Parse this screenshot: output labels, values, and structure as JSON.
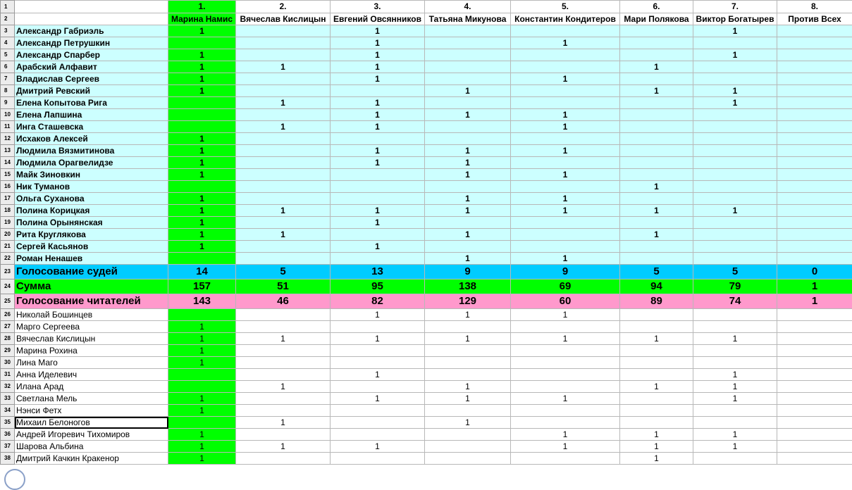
{
  "spreadsheet": {
    "row_numbers": [
      "1",
      "2",
      "3",
      "4",
      "5",
      "6",
      "7",
      "8",
      "9",
      "10",
      "11",
      "12",
      "13",
      "14",
      "15",
      "16",
      "17",
      "18",
      "19",
      "20",
      "21",
      "22",
      "23",
      "24",
      "25",
      "26",
      "27",
      "28",
      "29",
      "30",
      "31",
      "32",
      "33",
      "34",
      "35",
      "36",
      "37",
      "38"
    ],
    "candidate_numbers": [
      "1.",
      "2.",
      "3.",
      "4.",
      "5.",
      "6.",
      "7.",
      "8."
    ],
    "candidates": [
      "Марина Намис",
      "Вячеслав Кислицын",
      "Евгений Овсянников",
      "Татьяна Микунова",
      "Константин Кондитеров",
      "Мари Полякова",
      "Виктор Богатырев",
      "Против Всех"
    ],
    "judges": [
      {
        "name": "Александр Габриэль",
        "votes": [
          "1",
          "",
          "1",
          "",
          "",
          "",
          "1",
          ""
        ]
      },
      {
        "name": "Александр Петрушкин",
        "votes": [
          "",
          "",
          "1",
          "",
          "1",
          "",
          "",
          ""
        ]
      },
      {
        "name": "Александр Спарбер",
        "votes": [
          "1",
          "",
          "1",
          "",
          "",
          "",
          "1",
          ""
        ]
      },
      {
        "name": "Арабский Алфавит",
        "votes": [
          "1",
          "1",
          "1",
          "",
          "",
          "1",
          "",
          ""
        ]
      },
      {
        "name": "Владислав Сергеев",
        "votes": [
          "1",
          "",
          "1",
          "",
          "1",
          "",
          "",
          ""
        ]
      },
      {
        "name": "Дмитрий Ревский",
        "votes": [
          "1",
          "",
          "",
          "1",
          "",
          "1",
          "1",
          ""
        ]
      },
      {
        "name": "Елена Копытова Рига",
        "votes": [
          "",
          "1",
          "1",
          "",
          "",
          "",
          "1",
          ""
        ]
      },
      {
        "name": "Елена Лапшина",
        "votes": [
          "",
          "",
          "1",
          "1",
          "1",
          "",
          "",
          ""
        ]
      },
      {
        "name": "Инга Сташевска",
        "votes": [
          "",
          "1",
          "1",
          "",
          "1",
          "",
          "",
          ""
        ]
      },
      {
        "name": "Исхаков Алексей",
        "votes": [
          "1",
          "",
          "",
          "",
          "",
          "",
          "",
          ""
        ]
      },
      {
        "name": "Людмила Вязмитинова",
        "votes": [
          "1",
          "",
          "1",
          "1",
          "1",
          "",
          "",
          ""
        ]
      },
      {
        "name": "Людмила Орагвелидзе",
        "votes": [
          "1",
          "",
          "1",
          "1",
          "",
          "",
          "",
          ""
        ]
      },
      {
        "name": "Майк Зиновкин",
        "votes": [
          "1",
          "",
          "",
          "1",
          "1",
          "",
          "",
          ""
        ]
      },
      {
        "name": "Ник Туманов",
        "votes": [
          "",
          "",
          "",
          "",
          "",
          "1",
          "",
          ""
        ]
      },
      {
        "name": "Ольга Суханова",
        "votes": [
          "1",
          "",
          "",
          "1",
          "1",
          "",
          "",
          ""
        ]
      },
      {
        "name": "Полина Корицкая",
        "votes": [
          "1",
          "1",
          "1",
          "1",
          "1",
          "1",
          "1",
          ""
        ]
      },
      {
        "name": "Полина Орынянская",
        "votes": [
          "1",
          "",
          "1",
          "",
          "",
          "",
          "",
          ""
        ]
      },
      {
        "name": "Рита Круглякова",
        "votes": [
          "1",
          "1",
          "",
          "1",
          "",
          "1",
          "",
          ""
        ]
      },
      {
        "name": "Сергей Касьянов",
        "votes": [
          "1",
          "",
          "1",
          "",
          "",
          "",
          "",
          ""
        ]
      },
      {
        "name": "Роман Ненашев",
        "votes": [
          "",
          "",
          "",
          "1",
          "1",
          "",
          "",
          ""
        ]
      }
    ],
    "totals": [
      {
        "label": "Голосование судей",
        "values": [
          "14",
          "5",
          "13",
          "9",
          "9",
          "5",
          "5",
          "0"
        ]
      },
      {
        "label": "Сумма",
        "values": [
          "157",
          "51",
          "95",
          "138",
          "69",
          "94",
          "79",
          "1"
        ]
      },
      {
        "label": "Голосование читателей",
        "values": [
          "143",
          "46",
          "82",
          "129",
          "60",
          "89",
          "74",
          "1"
        ]
      }
    ],
    "readers": [
      {
        "name": "Николай Бошинцев",
        "votes": [
          "",
          "",
          "1",
          "1",
          "1",
          "",
          "",
          ""
        ]
      },
      {
        "name": "Марго Сергеева",
        "votes": [
          "1",
          "",
          "",
          "",
          "",
          "",
          "",
          ""
        ]
      },
      {
        "name": "Вячеслав Кислицын",
        "votes": [
          "1",
          "1",
          "1",
          "1",
          "1",
          "1",
          "1",
          ""
        ]
      },
      {
        "name": "Марина Рохина",
        "votes": [
          "1",
          "",
          "",
          "",
          "",
          "",
          "",
          ""
        ]
      },
      {
        "name": "Лина Маго",
        "votes": [
          "1",
          "",
          "",
          "",
          "",
          "",
          "",
          ""
        ]
      },
      {
        "name": "Анна Иделевич",
        "votes": [
          "",
          "",
          "1",
          "",
          "",
          "",
          "1",
          ""
        ]
      },
      {
        "name": "Илана Арад",
        "votes": [
          "",
          "1",
          "",
          "1",
          "",
          "1",
          "1",
          ""
        ]
      },
      {
        "name": "Светлана Мель",
        "votes": [
          "1",
          "",
          "1",
          "1",
          "1",
          "",
          "1",
          ""
        ]
      },
      {
        "name": "Нэнси Фетх",
        "votes": [
          "1",
          "",
          "",
          "",
          "",
          "",
          "",
          ""
        ]
      },
      {
        "name": "Михаил Белоногов",
        "votes": [
          "",
          "1",
          "",
          "1",
          "",
          "",
          "",
          ""
        ]
      },
      {
        "name": "Андрей Игоревич Тихомиров",
        "votes": [
          "1",
          "",
          "",
          "",
          "1",
          "1",
          "1",
          ""
        ]
      },
      {
        "name": "Шарова Альбина",
        "votes": [
          "1",
          "1",
          "1",
          "",
          "1",
          "1",
          "1",
          ""
        ]
      },
      {
        "name": "Дмитрий Качкин Кракенор",
        "votes": [
          "1",
          "",
          "",
          "",
          "",
          "1",
          "",
          ""
        ]
      }
    ],
    "selected_cell": "B35",
    "colors": {
      "highlight_column": "#00ff00",
      "judge_rows": "#ccffff",
      "judge_total": "#00ccff",
      "sum_total": "#00ff00",
      "reader_total": "#ff99cc"
    }
  }
}
